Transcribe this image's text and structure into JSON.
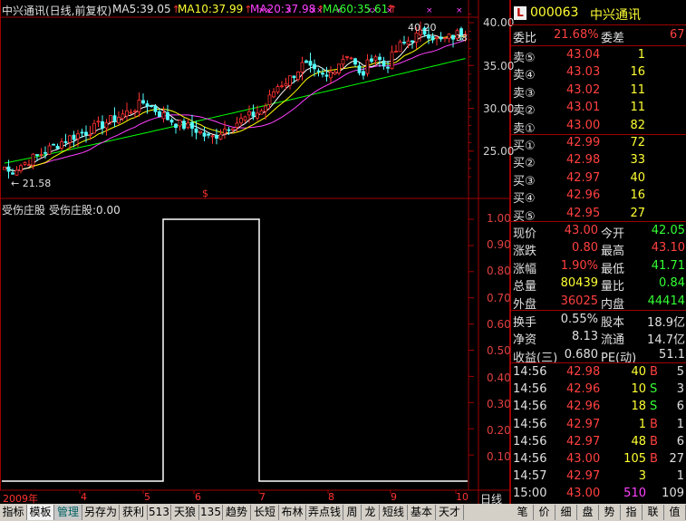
{
  "header": {
    "title": "中兴通讯(日线,前复权)",
    "ma5": "MA5:39.05",
    "ma10": "MA10:37.99",
    "ma20": "MA20:37.98",
    "ma60": "MA60:35.61",
    "colors": {
      "ma5": "#ffffff",
      "ma10": "#ffff00",
      "ma20": "#ff40ff",
      "ma60": "#00ff00"
    }
  },
  "price_axis": {
    "labels": [
      "40.00",
      "35.00",
      "30.00",
      "25.00"
    ]
  },
  "annotations": {
    "low": "21.58",
    "high": "40.20",
    "right_mark": "38",
    "marker": "$"
  },
  "indicator": {
    "title": "受伤庄股",
    "value_label": "受伤庄股:0.00",
    "axis_labels": [
      "1.00",
      "0.90",
      "0.80",
      "0.70",
      "0.60",
      "0.50",
      "0.40",
      "0.30",
      "0.20",
      "0.10"
    ]
  },
  "chart_data": {
    "type": "line",
    "title": "受伤庄股",
    "x": [
      "2009-03",
      "2009-04",
      "2009-05",
      "2009-06",
      "2009-07",
      "2009-08",
      "2009-09",
      "2009-10"
    ],
    "series": [
      {
        "name": "受伤庄股",
        "values": [
          0,
          0,
          1,
          1,
          0,
          0,
          0,
          0
        ]
      }
    ],
    "ylim": [
      0,
      1.0
    ]
  },
  "date_axis": {
    "labels": [
      "2009年",
      "4",
      "5",
      "6",
      "7",
      "8",
      "9",
      "10"
    ],
    "right_label": "日线"
  },
  "quote": {
    "badge": "L",
    "code": "000063",
    "name": "中兴通讯",
    "weibi_label": "委比",
    "weibi_value": "21.68%",
    "weicha_label": "委差",
    "weicha_value": "67",
    "sells": [
      {
        "label": "卖⑤",
        "price": "43.04",
        "vol": "1"
      },
      {
        "label": "卖④",
        "price": "43.03",
        "vol": "16"
      },
      {
        "label": "卖③",
        "price": "43.02",
        "vol": "11"
      },
      {
        "label": "卖②",
        "price": "43.01",
        "vol": "11"
      },
      {
        "label": "卖①",
        "price": "43.00",
        "vol": "82"
      }
    ],
    "buys": [
      {
        "label": "买①",
        "price": "42.99",
        "vol": "72"
      },
      {
        "label": "买②",
        "price": "42.98",
        "vol": "33"
      },
      {
        "label": "买③",
        "price": "42.97",
        "vol": "40"
      },
      {
        "label": "买④",
        "price": "42.96",
        "vol": "16"
      },
      {
        "label": "买⑤",
        "price": "42.95",
        "vol": "27"
      }
    ],
    "stats": [
      {
        "l1": "现价",
        "v1": "43.00",
        "l2": "今开",
        "v2": "42.05"
      },
      {
        "l1": "涨跌",
        "v1": "0.80",
        "l2": "最高",
        "v2": "43.10"
      },
      {
        "l1": "涨幅",
        "v1": "1.90%",
        "l2": "最低",
        "v2": "41.71"
      },
      {
        "l1": "总量",
        "v1": "80439",
        "l2": "量比",
        "v2": "0.84"
      },
      {
        "l1": "外盘",
        "v1": "36025",
        "l2": "内盘",
        "v2": "44414"
      }
    ],
    "fund": [
      {
        "l1": "换手",
        "v1": "0.55%",
        "l2": "股本",
        "v2": "18.9亿"
      },
      {
        "l1": "净资",
        "v1": "8.13",
        "l2": "流通",
        "v2": "14.7亿"
      },
      {
        "l1": "收益(三)",
        "v1": "0.680",
        "l2": "PE(动)",
        "v2": "51.1"
      }
    ],
    "ticks": [
      {
        "time": "14:56",
        "price": "42.98",
        "vol": "40",
        "bs": "B",
        "n": "5"
      },
      {
        "time": "14:56",
        "price": "42.96",
        "vol": "10",
        "bs": "S",
        "n": "3"
      },
      {
        "time": "14:56",
        "price": "42.96",
        "vol": "18",
        "bs": "S",
        "n": "6"
      },
      {
        "time": "14:56",
        "price": "42.97",
        "vol": "1",
        "bs": "B",
        "n": "1"
      },
      {
        "time": "14:56",
        "price": "42.97",
        "vol": "48",
        "bs": "B",
        "n": "6"
      },
      {
        "time": "14:56",
        "price": "43.00",
        "vol": "105",
        "bs": "B",
        "n": "27"
      },
      {
        "time": "14:57",
        "price": "42.97",
        "vol": "3",
        "bs": "",
        "n": "1"
      },
      {
        "time": "15:00",
        "price": "43.00",
        "vol": "510",
        "bs": "",
        "n": "109"
      }
    ]
  },
  "bottom_tabs": [
    "指标",
    "模板",
    "管理",
    "另存为",
    "获利",
    "513",
    "天狼",
    "135",
    "趋势",
    "长短",
    "布林",
    "弄点钱",
    "周",
    "龙",
    "短线",
    "基本",
    "天才"
  ],
  "right_tabs": [
    "笔",
    "价",
    "细",
    "盘",
    "势",
    "指",
    "联",
    "值"
  ]
}
